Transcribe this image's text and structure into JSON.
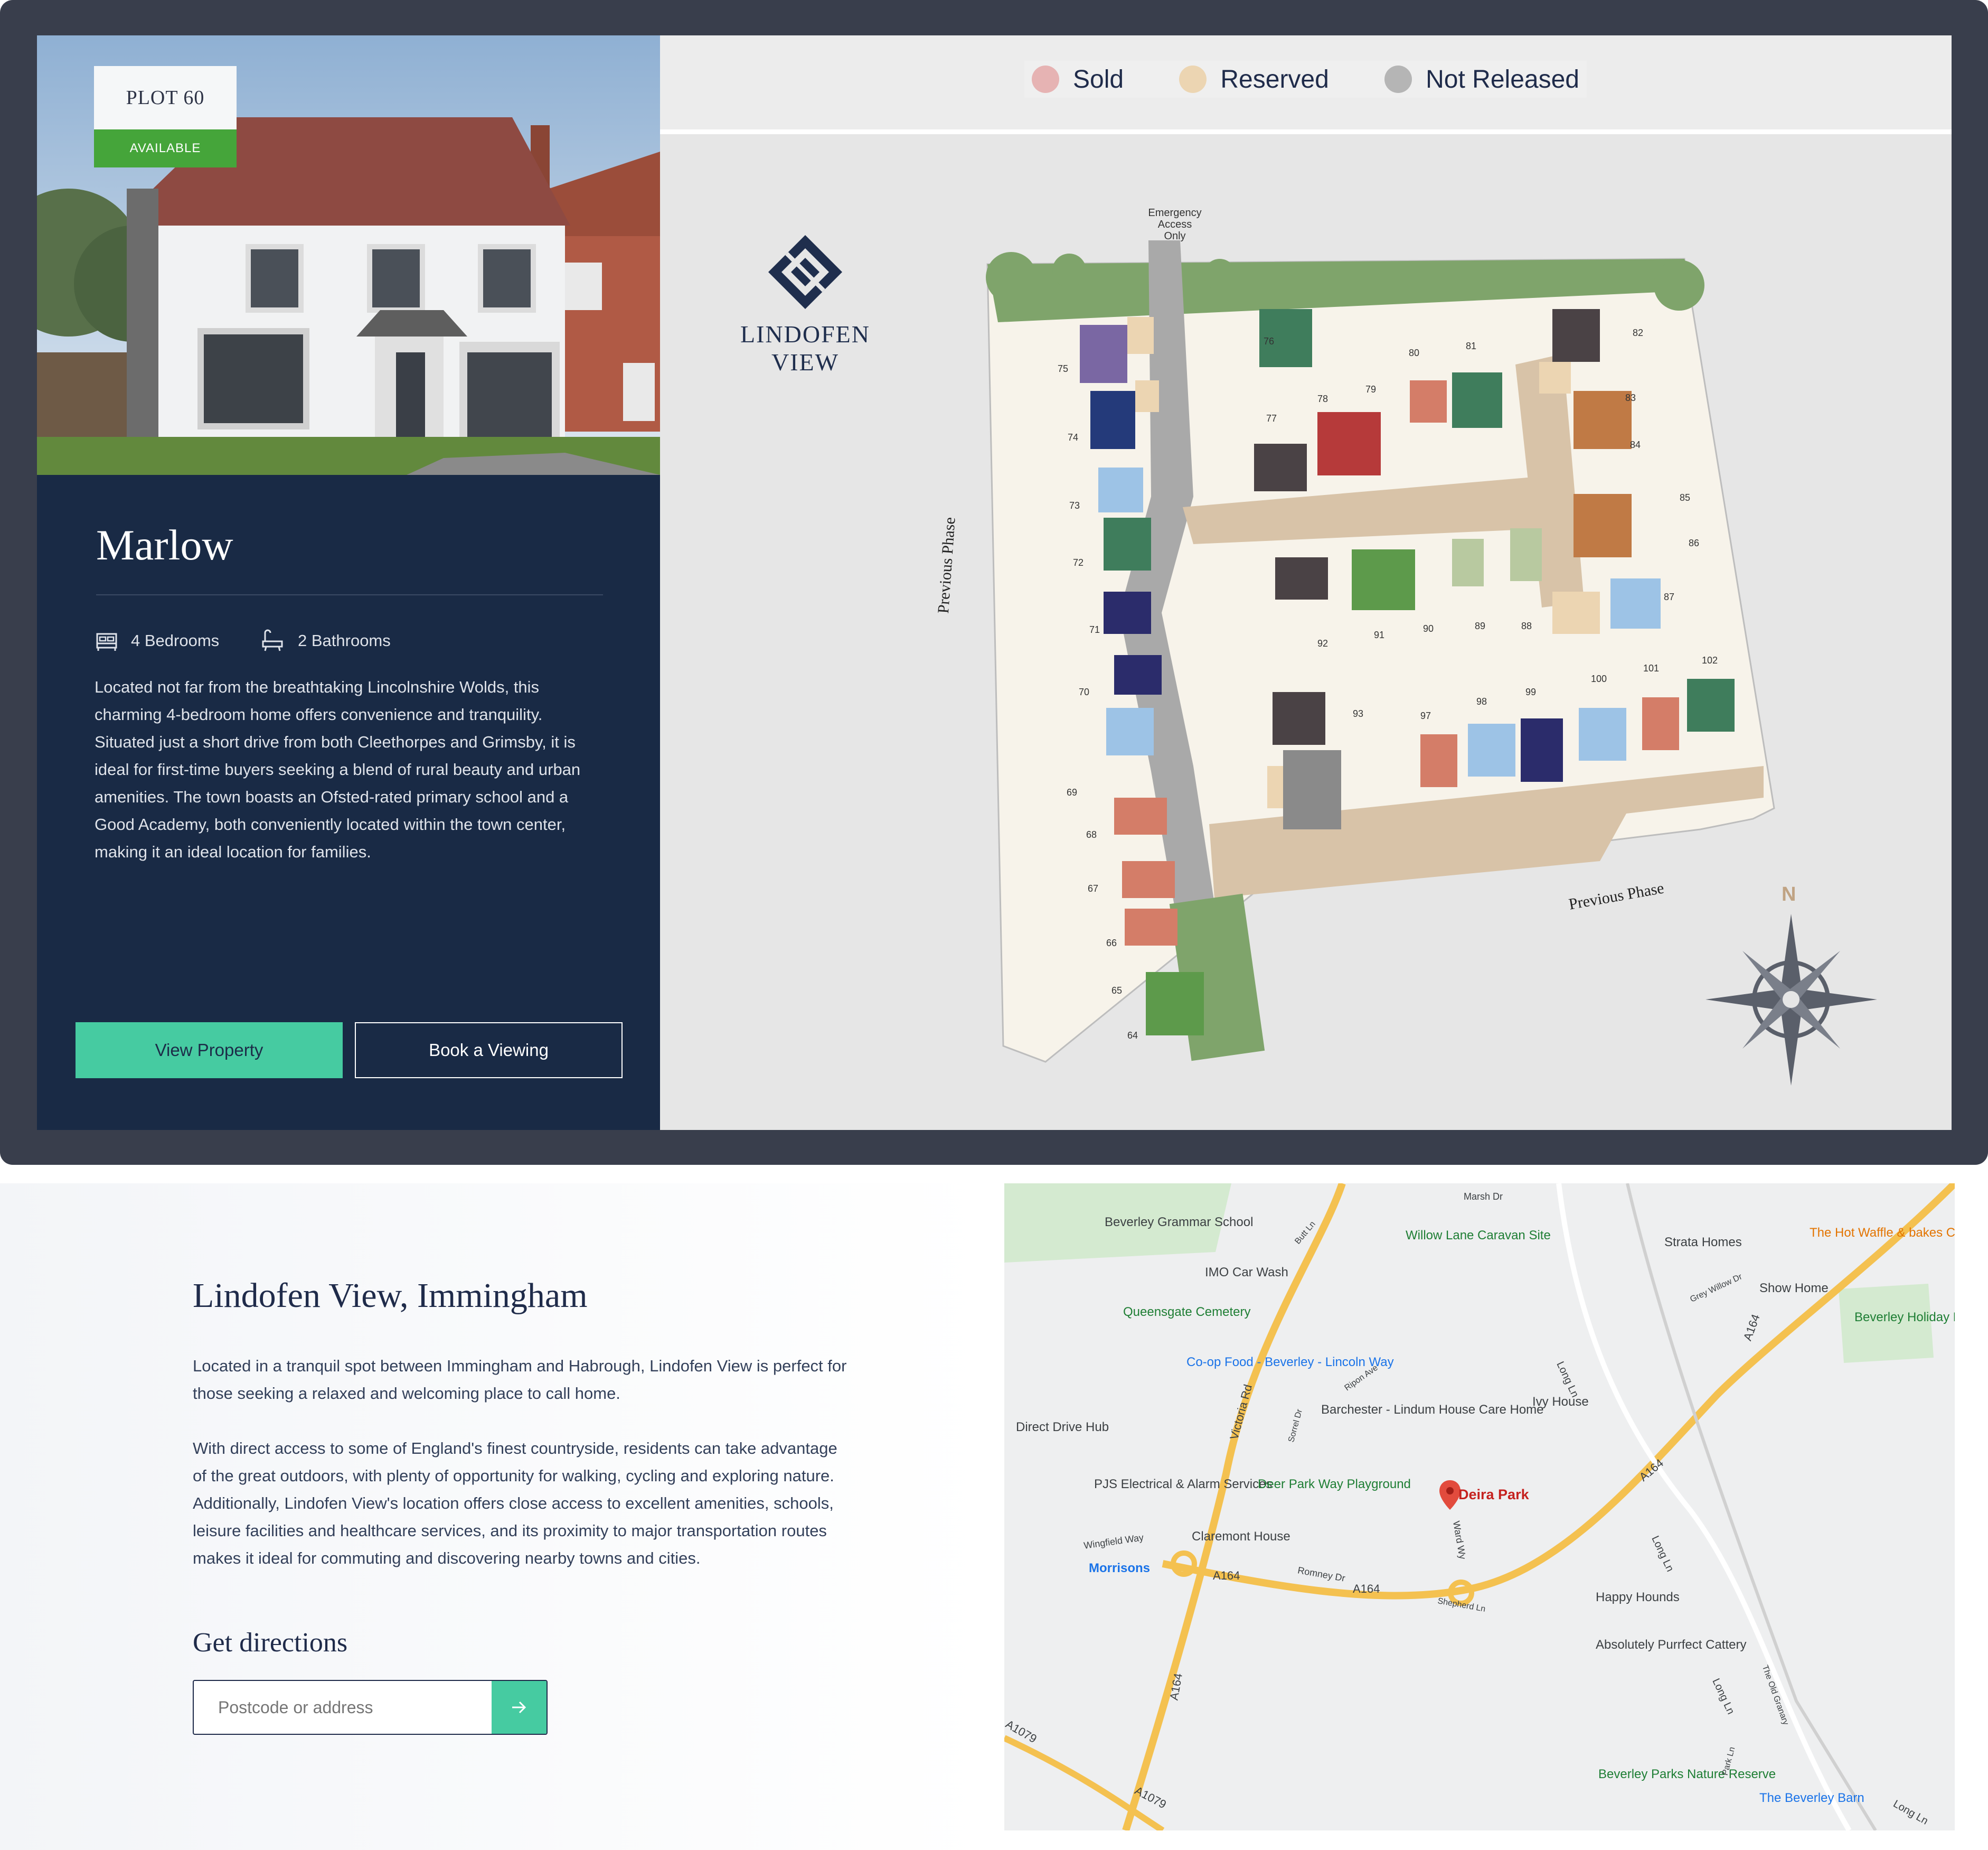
{
  "plot": {
    "number_label": "PLOT 60",
    "status": "AVAILABLE",
    "house_name": "Marlow",
    "bedrooms": "4 Bedrooms",
    "bathrooms": "2 Bathrooms",
    "description": "Located not far from the breathtaking Lincolnshire Wolds, this charming 4-bedroom home offers convenience and tranquility. Situated just a short drive from both Cleethorpes and Grimsby, it is ideal for first-time buyers seeking a blend of rural beauty and urban amenities. The town boasts an Ofsted-rated primary school and a Good Academy, both conveniently located within the town center, making it an ideal location for families.",
    "view_button": "View Property",
    "book_button": "Book a Viewing"
  },
  "legend": [
    {
      "label": "Sold",
      "color": "#e6b3b3"
    },
    {
      "label": "Reserved",
      "color": "#ecd5b2"
    },
    {
      "label": "Not Released",
      "color": "#b5b5b5"
    }
  ],
  "siteplan": {
    "brand": "LINDOFEN VIEW",
    "emergency_access_line1": "Emergency",
    "emergency_access_line2": "Access Only",
    "previous_phase_left": "Previous Phase",
    "previous_phase_bottom": "Previous Phase",
    "compass_n": "N",
    "plot_numbers": [
      "64",
      "65",
      "66",
      "67",
      "68",
      "69",
      "70",
      "71",
      "72",
      "73",
      "74",
      "75",
      "76",
      "77",
      "78",
      "79",
      "80",
      "81",
      "82",
      "83",
      "84",
      "85",
      "86",
      "87",
      "88",
      "89",
      "90",
      "91",
      "92",
      "93",
      "97",
      "98",
      "99",
      "100",
      "101",
      "102"
    ]
  },
  "location": {
    "title": "Lindofen View, Immingham",
    "para1": "Located in a tranquil spot between Immingham and Habrough, Lindofen View is perfect for those seeking a relaxed and welcoming place to call home.",
    "para2": "With direct access to some of England's finest countryside, residents can take advantage of the great outdoors, with plenty of opportunity for walking, cycling and exploring nature. Additionally, Lindofen View's location offers close access to excellent amenities, schools, leisure facilities and healthcare services, and its proximity to major transportation routes makes it ideal for commuting and discovering nearby towns and cities.",
    "directions_heading": "Get directions",
    "input_placeholder": "Postcode or address"
  },
  "map_labels": {
    "grammar_school": "Beverley Grammar School",
    "imo": "IMO Car Wash",
    "willow": "Willow Lane Caravan Site",
    "strata": "Strata Homes",
    "waffle": "The Hot Waffle & bakes Co",
    "show_home": "Show Home",
    "holiday_park": "Beverley Holiday Park",
    "cemetery": "Queensgate Cemetery",
    "coop": "Co-op Food - Beverley - Lincoln Way",
    "direct_drive": "Direct Drive Hub",
    "barchester": "Barchester - Lindum House Care Home",
    "ivy": "Ivy House",
    "pjs": "PJS Electrical & Alarm Services",
    "deer_park": "Deer Park Way Playground",
    "deira": "Deira Park",
    "claremont": "Claremont House",
    "morrisons": "Morrisons",
    "happy_hounds": "Happy Hounds",
    "cattery": "Absolutely Purrfect Cattery",
    "nature_reserve": "Beverley Parks Nature Reserve",
    "barn": "The Beverley Barn",
    "victoria_rd": "Victoria Rd",
    "a164": "A164",
    "a1079": "A1079",
    "long_ln": "Long Ln",
    "shepherd_ln": "Shepherd Ln",
    "marsh_dr": "Marsh Dr",
    "ward_wy": "Ward Wy",
    "romney_dr": "Romney Dr",
    "wingfield_way": "Wingfield Way",
    "grey_willow": "Grey Willow Dr",
    "old_granary": "The Old Granary",
    "park_ln": "Park Ln",
    "sorrel_dr": "Sorrel Dr",
    "ripon_ave": "Ripon Ave",
    "butt_ln": "Butt Ln"
  }
}
